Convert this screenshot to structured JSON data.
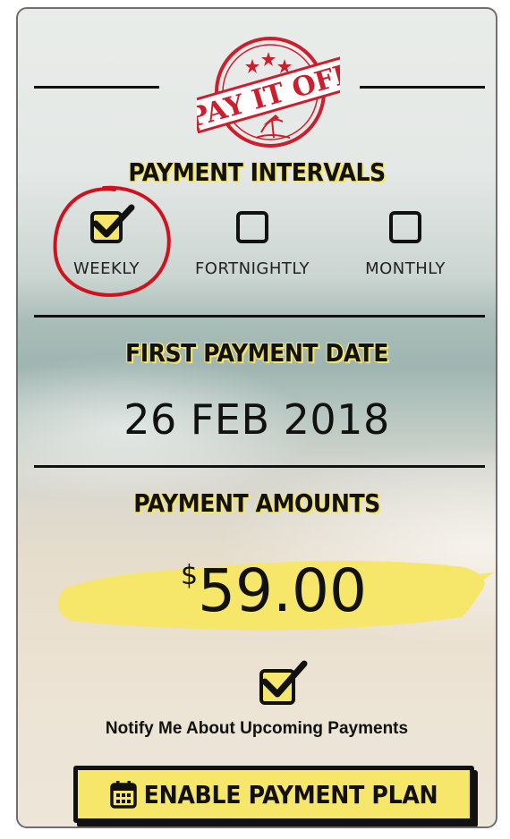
{
  "brand": {
    "stamp_text": "PAY IT OFF",
    "stamp_color": "#cc1f2e"
  },
  "accent_color": "#f6e66a",
  "payment_intervals": {
    "title": "PAYMENT INTERVALS",
    "options": [
      {
        "label": "WEEKLY",
        "checked": true,
        "highlighted": true
      },
      {
        "label": "FORTNIGHTLY",
        "checked": false
      },
      {
        "label": "MONTHLY",
        "checked": false
      }
    ]
  },
  "first_payment": {
    "title": "FIRST PAYMENT DATE",
    "date": "26 FEB 2018"
  },
  "payment_amounts": {
    "title": "PAYMENT AMOUNTS",
    "currency": "$",
    "amount": "59.00"
  },
  "notify": {
    "label": "Notify Me About Upcoming Payments",
    "checked": true
  },
  "button": {
    "label": "ENABLE PAYMENT PLAN",
    "icon": "calendar-icon"
  }
}
